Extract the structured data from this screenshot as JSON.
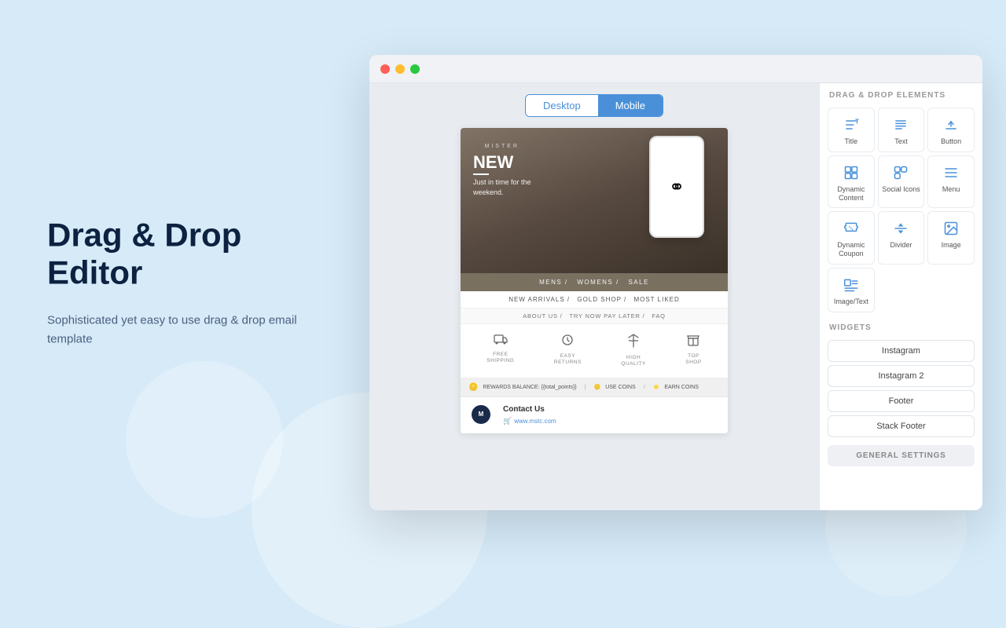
{
  "left": {
    "heading": "Drag & Drop Editor",
    "description": "Sophisticated yet easy to use drag & drop email template"
  },
  "browser": {
    "titlebar": {
      "circles": [
        "red",
        "yellow",
        "green"
      ]
    },
    "view_toggle": {
      "desktop_label": "Desktop",
      "mobile_label": "Mobile"
    },
    "email_preview": {
      "hero": {
        "logo_text": "MISTER",
        "new_label": "NEW",
        "subtitle": "Just in time for the\nweekend."
      },
      "nav": {
        "items": [
          "MENS /",
          "WOMENS /",
          "SALE"
        ]
      },
      "sub_nav": {
        "items": [
          "NEW ARRIVALS /",
          "GOLD SHOP /",
          "MOST LIKED"
        ]
      },
      "about_nav": {
        "items": [
          "ABOUT US /",
          "TRY NOW PAY LATER /",
          "FAQ"
        ]
      },
      "features": [
        {
          "icon": "🛒",
          "label": "FREE\nSHIPPING"
        },
        {
          "icon": "↩",
          "label": "EASY\nRETURNS"
        },
        {
          "icon": "⬆",
          "label": "HIGH\nQUALITY"
        },
        {
          "icon": "🛒",
          "label": "TOP\nSHOP"
        }
      ],
      "rewards": {
        "text": "REWARDS BALANCE: {{total_points}}",
        "use_coins": "USE COINS",
        "earn_coins": "EARN COINS"
      },
      "footer": {
        "contact_title": "Contact Us",
        "website": "www.mstc.com"
      }
    }
  },
  "right_panel": {
    "elements_title": "DRAG & DROP ELEMENTS",
    "elements": [
      {
        "icon": "title",
        "label": "Title"
      },
      {
        "icon": "text",
        "label": "Text"
      },
      {
        "icon": "button",
        "label": "Button"
      },
      {
        "icon": "dynamic_content",
        "label": "Dynamic\nContent"
      },
      {
        "icon": "social_icons",
        "label": "Social Icons"
      },
      {
        "icon": "menu",
        "label": "Menu"
      },
      {
        "icon": "dynamic_coupon",
        "label": "Dynamic\nCoupon"
      },
      {
        "icon": "divider",
        "label": "Divider"
      },
      {
        "icon": "image",
        "label": "Image"
      },
      {
        "icon": "image_text",
        "label": "Image/Text"
      }
    ],
    "widgets_title": "WIDGETS",
    "widgets": [
      "Instagram",
      "Instagram 2",
      "Footer",
      "Stack Footer"
    ],
    "general_settings_label": "GENERAL SETTINGS"
  }
}
